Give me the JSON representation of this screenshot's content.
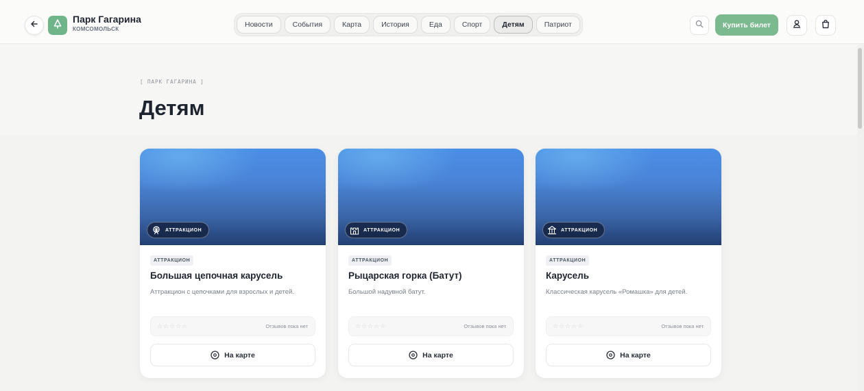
{
  "header": {
    "brand_title": "Парк Гагарина",
    "brand_subtitle": "КОМСОМОЛЬСК",
    "buy_label": "Купить билет",
    "accent_color": "#7bb98e"
  },
  "nav": {
    "items": [
      "Новости",
      "События",
      "Карта",
      "История",
      "Еда",
      "Спорт",
      "Детям",
      "Патриот"
    ],
    "active": "Детям"
  },
  "page": {
    "breadcrumb": "[ ПАРК ГАГАРИНА ]",
    "title": "Детям"
  },
  "cards": [
    {
      "badge": "АТТРАКЦИОН",
      "badge_icon": "ferris-wheel-icon",
      "tag": "АТТРАКЦИОН",
      "title": "Большая цепочная карусель",
      "description": "Аттракцион с цепочками для взрослых и детей.",
      "stars": "☆☆☆☆☆",
      "reviews": "Отзывов пока нет",
      "map_label": "На карте"
    },
    {
      "badge": "АТТРАКЦИОН",
      "badge_icon": "castle-icon",
      "tag": "АТТРАКЦИОН",
      "title": "Рыцарская горка (Батут)",
      "description": "Большой надувной батут.",
      "stars": "☆☆☆☆☆",
      "reviews": "Отзывов пока нет",
      "map_label": "На карте"
    },
    {
      "badge": "АТТРАКЦИОН",
      "badge_icon": "carousel-icon",
      "tag": "АТТРАКЦИОН",
      "title": "Карусель",
      "description": "Классическая карусель «Ромашка» для детей.",
      "stars": "☆☆☆☆☆",
      "reviews": "Отзывов пока нет",
      "map_label": "На карте"
    }
  ]
}
